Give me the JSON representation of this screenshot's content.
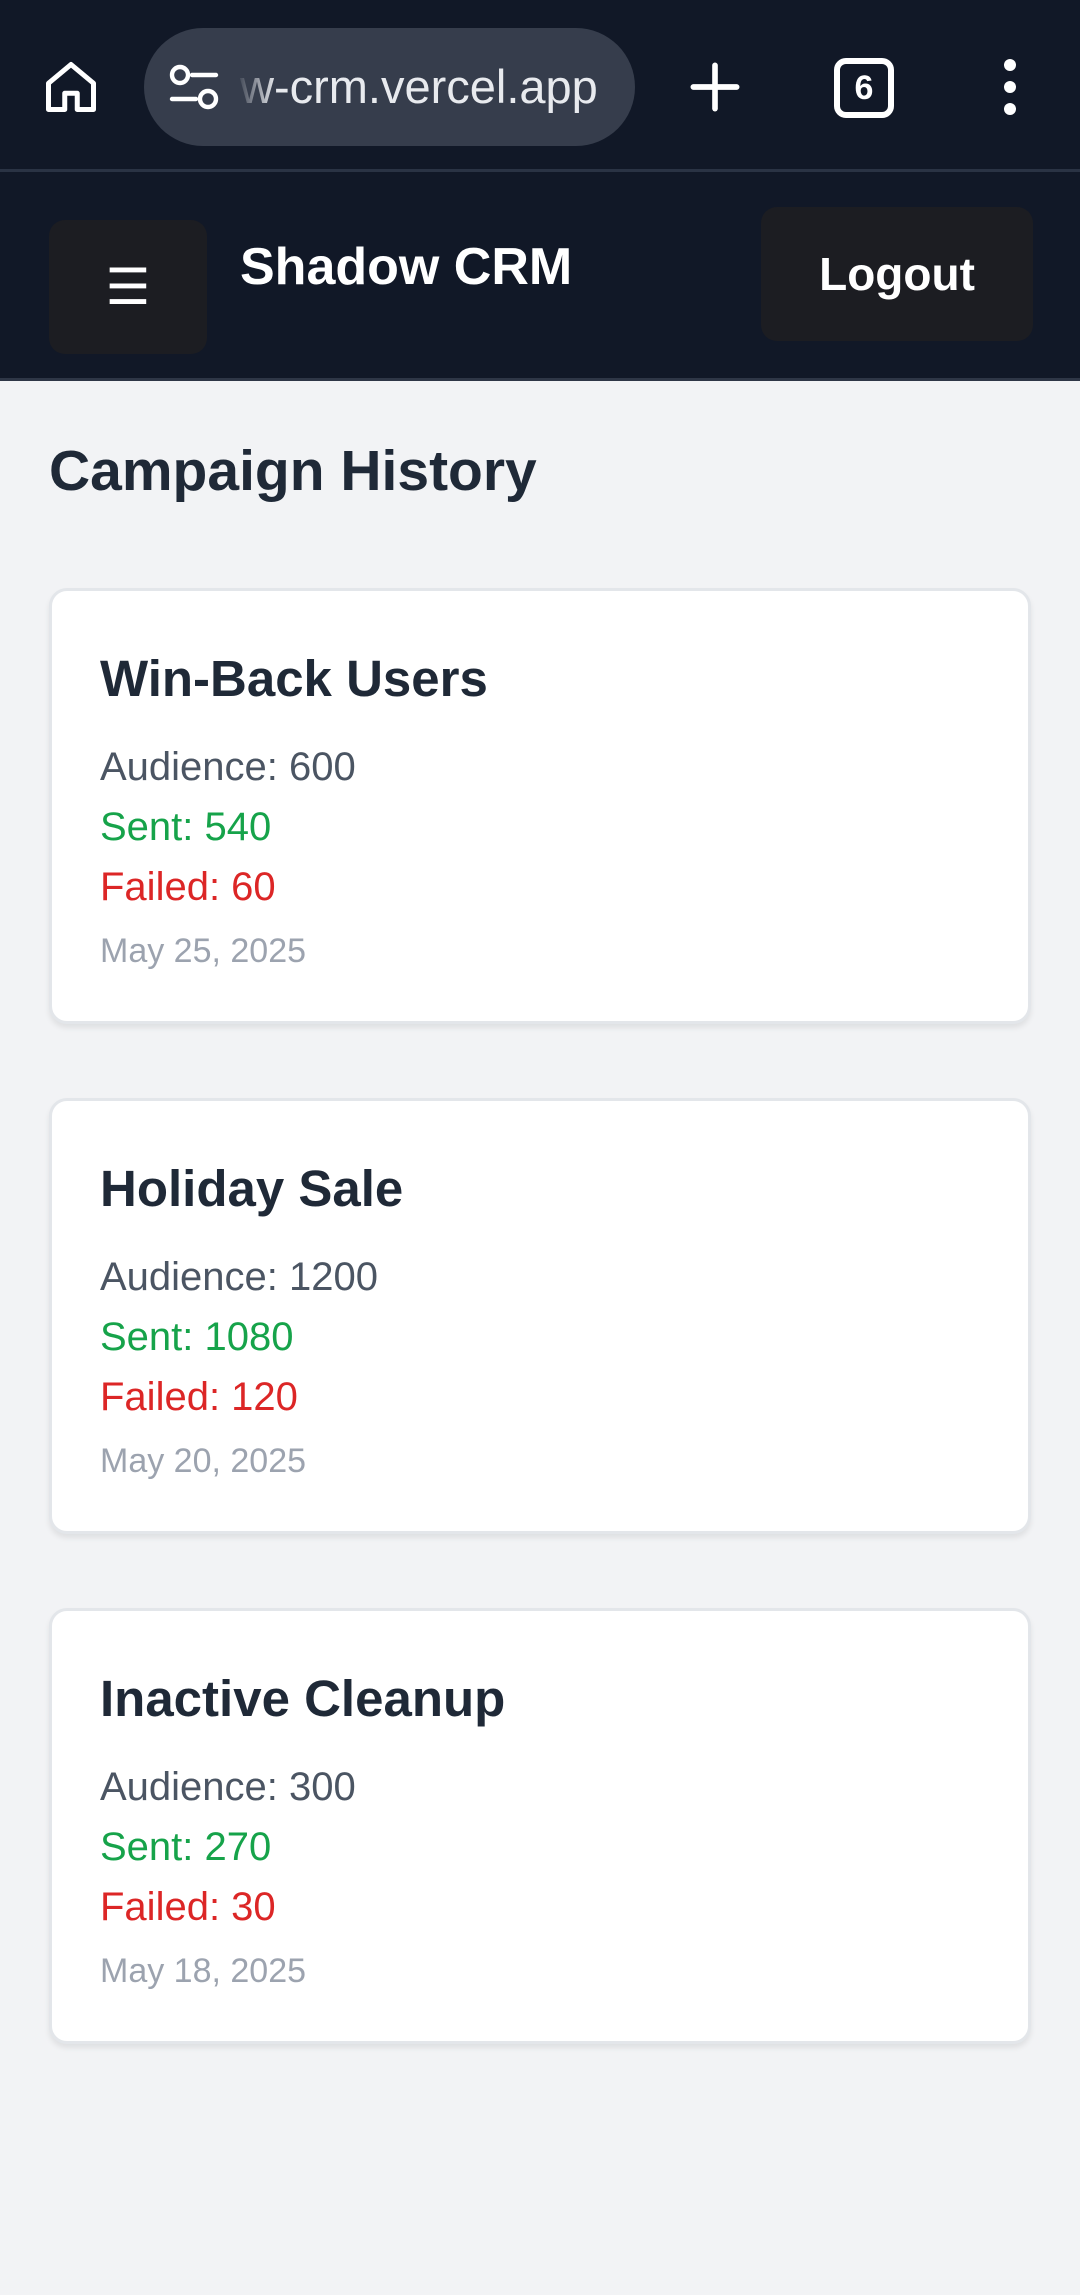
{
  "browser": {
    "url_text": "w-crm.vercel.app",
    "tab_count": "6"
  },
  "header": {
    "menu_glyph": "☰",
    "brand": "Shadow CRM",
    "logout_label": "Logout"
  },
  "page": {
    "title": "Campaign History"
  },
  "campaigns": [
    {
      "name": "Win-Back Users",
      "audience": "Audience: 600",
      "sent": "Sent: 540",
      "failed": "Failed: 60",
      "date": "May 25, 2025"
    },
    {
      "name": "Holiday Sale",
      "audience": "Audience: 1200",
      "sent": "Sent: 1080",
      "failed": "Failed: 120",
      "date": "May 20, 2025"
    },
    {
      "name": "Inactive Cleanup",
      "audience": "Audience: 300",
      "sent": "Sent: 270",
      "failed": "Failed: 30",
      "date": "May 18, 2025"
    }
  ],
  "colors": {
    "header_bg": "#111827",
    "sent": "#16a34a",
    "failed": "#dc2626"
  },
  "icons": {
    "home": "home-icon",
    "site_settings": "tune-icon",
    "new_tab": "plus-icon",
    "tabs": "tab-switcher-icon",
    "menu": "more-vert-icon"
  }
}
